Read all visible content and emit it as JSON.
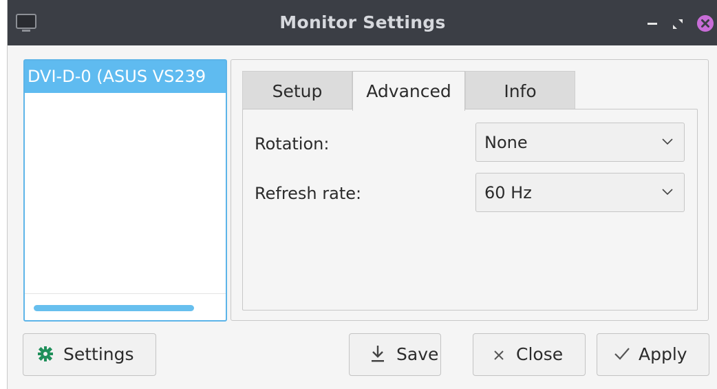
{
  "window": {
    "title": "Monitor Settings"
  },
  "icons": {
    "app": "monitor-icon",
    "minimize": "minimize-icon",
    "restore": "restore-icon",
    "close": "close-icon",
    "settings": "gear-icon",
    "save": "download-icon",
    "close_btn": "x-icon",
    "apply": "checkmark-icon",
    "dropdown": "chevron-down-icon"
  },
  "colors": {
    "titlebar": "#3b3e45",
    "selection": "#5fbbf0",
    "close_button": "#c86dd7",
    "settings_icon": "#1f8f5a"
  },
  "monitor_list": {
    "items": [
      {
        "label": "DVI-D-0 (ASUS VS239"
      }
    ]
  },
  "tabs": [
    {
      "label": "Setup"
    },
    {
      "label": "Advanced",
      "selected": true
    },
    {
      "label": "Info"
    }
  ],
  "advanced": {
    "rotation_label": "Rotation:",
    "rotation_value": "None",
    "refresh_label": "Refresh rate:",
    "refresh_value": "60 Hz"
  },
  "buttons": {
    "settings": "Settings",
    "save": "Save",
    "close": "Close",
    "apply": "Apply"
  }
}
